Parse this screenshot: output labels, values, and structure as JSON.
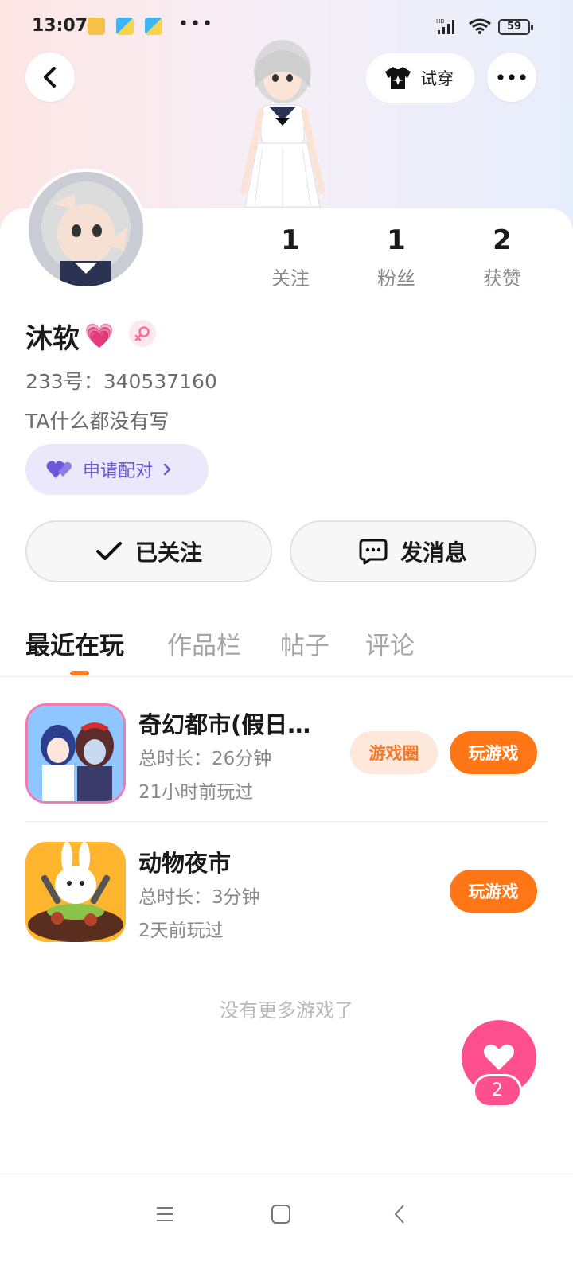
{
  "status_bar": {
    "time": "13:07",
    "dots": "•••",
    "battery": "59",
    "network_label": "HD"
  },
  "header": {
    "back_icon": "chevron-left-icon",
    "tryon_label": "试穿",
    "more_icon": "more-dots-icon"
  },
  "profile": {
    "nickname": "沐软",
    "nickname_emoji": "💗",
    "id_line": "233号：340537160",
    "bio": "TA什么都没有写",
    "pair_label": "申请配对",
    "stats": [
      {
        "value": "1",
        "label": "关注"
      },
      {
        "value": "1",
        "label": "粉丝"
      },
      {
        "value": "2",
        "label": "获赞"
      }
    ],
    "gender_color": "#ff6a96"
  },
  "actions": {
    "follow_label": "已关注",
    "message_label": "发消息"
  },
  "tabs": [
    {
      "label": "最近在玩",
      "active": true
    },
    {
      "label": "作品栏",
      "active": false
    },
    {
      "label": "帖子",
      "active": false
    },
    {
      "label": "评论",
      "active": false
    }
  ],
  "games": [
    {
      "name": "奇幻都市(假日…",
      "duration": "总时长：26分钟",
      "last_played": "21小时前玩过",
      "circle_label": "游戏圈",
      "play_label": "玩游戏"
    },
    {
      "name": "动物夜市",
      "duration": "总时长：3分钟",
      "last_played": "2天前玩过",
      "play_label": "玩游戏"
    }
  ],
  "footer": {
    "no_more": "没有更多游戏了"
  },
  "fab": {
    "count": "2"
  },
  "colors": {
    "accent_orange": "#ff7616",
    "pair_purple": "#6a59d8",
    "fab_pink": "#ff4f8c"
  }
}
